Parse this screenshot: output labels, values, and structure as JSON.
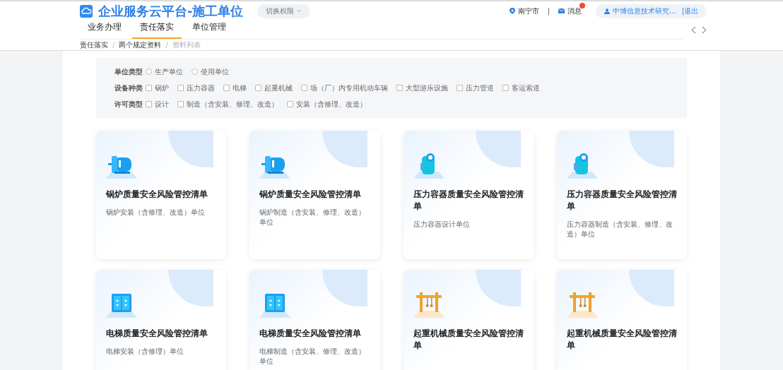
{
  "header": {
    "title": "企业服务云平台-施工单位",
    "role_switch": "切换权限",
    "location": "南宁市",
    "separator": "|",
    "messages": {
      "label": "消息",
      "unread": true
    },
    "user": {
      "name": "中博信息技术研究...",
      "logout": "|退出"
    }
  },
  "tabs": [
    {
      "label": "业务办理",
      "selected": false
    },
    {
      "label": "责任落实",
      "selected": true
    },
    {
      "label": "单位管理",
      "selected": false
    }
  ],
  "breadcrumb": [
    {
      "label": "责任落实",
      "current": false
    },
    {
      "label": "两个规定资料",
      "current": false
    },
    {
      "label": "资料列表",
      "current": true
    }
  ],
  "breadcrumb_separator": "/",
  "filters": [
    {
      "label": "单位类型",
      "kind": "radio",
      "options": [
        {
          "label": "生产单位",
          "selected": false
        },
        {
          "label": "使用单位",
          "selected": false
        }
      ]
    },
    {
      "label": "设备种类",
      "kind": "checkbox",
      "options": [
        {
          "label": "锅炉",
          "checked": false
        },
        {
          "label": "压力容器",
          "checked": false
        },
        {
          "label": "电梯",
          "checked": false
        },
        {
          "label": "起重机械",
          "checked": false
        },
        {
          "label": "场（厂）内专用机动车辆",
          "checked": false
        },
        {
          "label": "大型游乐设施",
          "checked": false
        },
        {
          "label": "压力管道",
          "checked": false
        },
        {
          "label": "客运索道",
          "checked": false
        }
      ]
    },
    {
      "label": "许可类型",
      "kind": "checkbox",
      "options": [
        {
          "label": "设计",
          "checked": false
        },
        {
          "label": "制造（含安装、修理、改造）",
          "checked": false
        },
        {
          "label": "安装（含修理、改造）",
          "checked": false
        }
      ]
    }
  ],
  "cards": [
    {
      "kind": "boiler",
      "title": "锅炉质量安全风险管控清单",
      "subtitle": "锅炉安装（含修理、改造）单位"
    },
    {
      "kind": "boiler",
      "title": "锅炉质量安全风险管控清单",
      "subtitle": "锅炉制造（含安装、修理、改造）单位"
    },
    {
      "kind": "vessel",
      "title": "压力容器质量安全风险管控清单",
      "subtitle": "压力容器设计单位"
    },
    {
      "kind": "vessel",
      "title": "压力容器质量安全风险管控清单",
      "subtitle": "压力容器制造（含安装、修理、改造）单位"
    },
    {
      "kind": "elevator",
      "title": "电梯质量安全风险管控清单",
      "subtitle": "电梯安装（含修理）单位"
    },
    {
      "kind": "elevator",
      "title": "电梯质量安全风险管控清单",
      "subtitle": "电梯制造（含安装、修理、改造）单位"
    },
    {
      "kind": "crane",
      "title": "起重机械质量安全风险管控清单"
    },
    {
      "kind": "crane",
      "title": "起重机械质量安全风险管控清单"
    }
  ]
}
